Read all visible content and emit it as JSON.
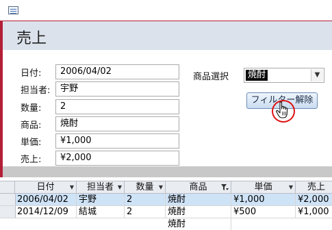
{
  "form": {
    "title": "売上",
    "fields": [
      {
        "label": "日付:",
        "value": "2006/04/02"
      },
      {
        "label": "担当者:",
        "value": "宇野"
      },
      {
        "label": "数量:",
        "value": "2"
      },
      {
        "label": "商品:",
        "value": "焼酎"
      },
      {
        "label": "単価:",
        "value": "¥1,000"
      },
      {
        "label": "売上:",
        "value": "¥2,000"
      }
    ],
    "product_select": {
      "label": "商品選択",
      "value": "焼酎",
      "arrow_icon": "chevron-down-icon"
    },
    "filter_clear_button": "フィルター解除",
    "cursor_icon": "hand-pointer-icon",
    "highlight_color": "#e01010"
  },
  "datasheet": {
    "columns": [
      "日付",
      "担当者",
      "数量",
      "商品",
      "単価",
      "売上"
    ],
    "filter_icon_column": "商品",
    "rows": [
      [
        "2006/04/02",
        "宇野",
        "2",
        "焼酎",
        "¥1,000",
        "¥2,000"
      ],
      [
        "2014/12/09",
        "結城",
        "2",
        "焼酎",
        "¥500",
        "¥1,000"
      ],
      [
        "",
        "",
        "",
        "焼酎",
        "",
        ""
      ]
    ],
    "selected_row_color": "#cfe3f7"
  }
}
